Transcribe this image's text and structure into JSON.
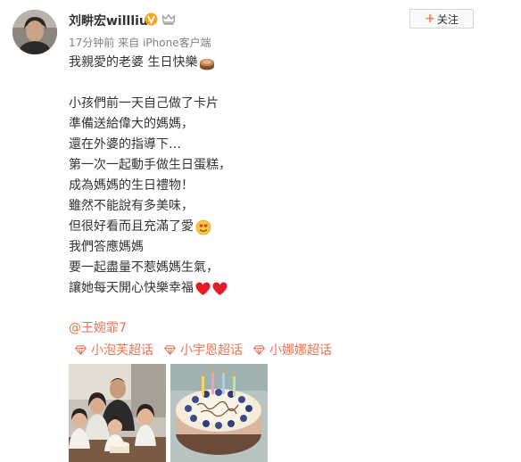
{
  "post": {
    "username": "刘畊宏willliu",
    "time": "17分钟前",
    "source": "来自 iPhone客户端",
    "follow_label": "关注",
    "lines": [
      "我親愛的老婆 生日快樂",
      "",
      "小孩們前一天自己做了卡片",
      "準備送給偉大的媽媽，",
      "還在外婆的指導下…",
      "第一次一起動手做生日蛋糕，",
      "成為媽媽的生日禮物！",
      "雖然不能說有多美味，",
      "但很好看而且充滿了愛",
      "我們答應媽媽",
      "要一起盡量不惹媽媽生氣，",
      "讓她每天開心快樂幸福"
    ],
    "mention": "@王婉霏7",
    "topics": [
      {
        "label": "小泡芙超话"
      },
      {
        "label": "小宇恩超话"
      },
      {
        "label": "小娜娜超话"
      }
    ]
  },
  "icons": {
    "cake_emoji": "cake-icon",
    "love_emoji": "heart-eyes-face-icon",
    "heart": "red-heart-icon",
    "topic": "diamond-topic-icon",
    "vip": "gold-v-verified-icon",
    "crown": "crown-icon"
  },
  "colors": {
    "accent": "#eb7350",
    "follow_plus": "#ff8140",
    "meta_text": "#808080",
    "body_text": "#333333",
    "vip_gold": "#f5a623"
  }
}
